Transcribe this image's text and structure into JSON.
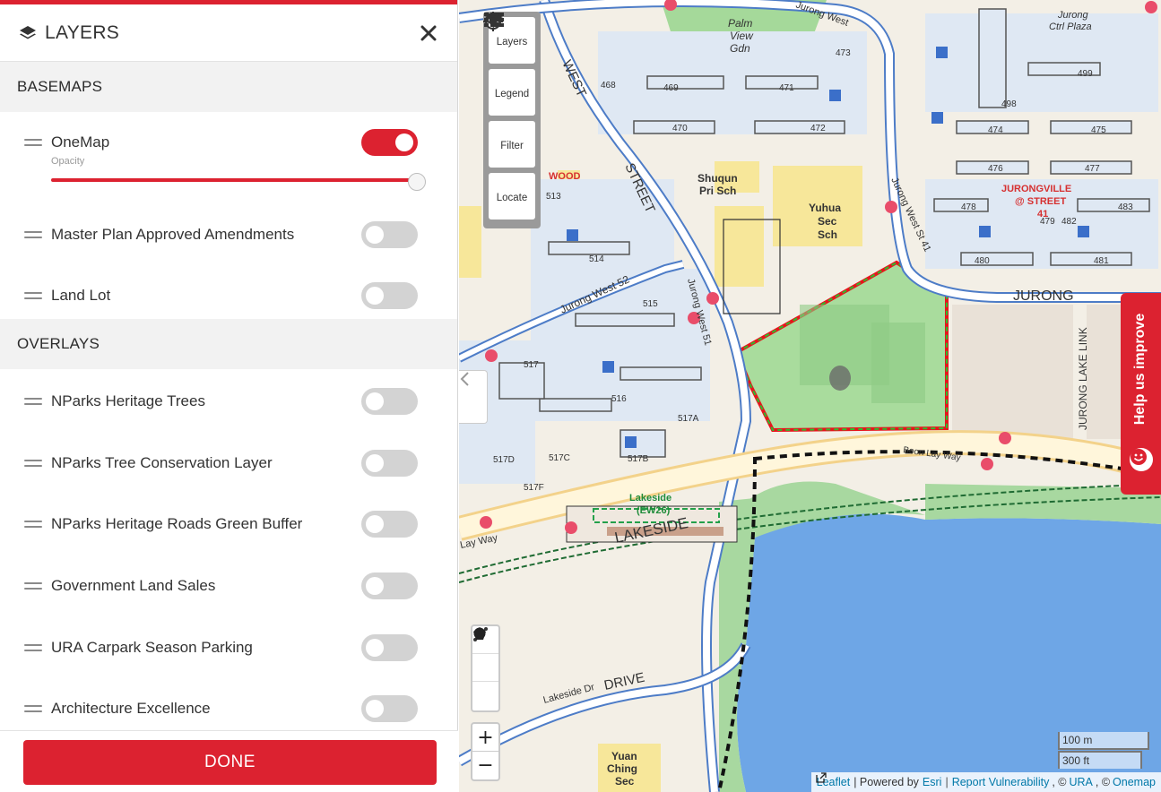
{
  "panel": {
    "title": "LAYERS",
    "close_icon": "close-icon",
    "basemaps_heading": "BASEMAPS",
    "overlays_heading": "OVERLAYS",
    "basemaps": [
      {
        "label": "OneMap",
        "enabled": true,
        "opacity_label": "Opacity",
        "opacity": 1.0
      },
      {
        "label": "Master Plan Approved Amendments",
        "enabled": false
      },
      {
        "label": "Land Lot",
        "enabled": false
      }
    ],
    "overlays": [
      {
        "label": "NParks Heritage Trees",
        "enabled": false
      },
      {
        "label": "NParks Tree Conservation Layer",
        "enabled": false
      },
      {
        "label": "NParks Heritage Roads Green Buffer",
        "enabled": false
      },
      {
        "label": "Government Land Sales",
        "enabled": false
      },
      {
        "label": "URA Carpark Season Parking",
        "enabled": false
      },
      {
        "label": "Architecture Excellence",
        "enabled": false
      }
    ],
    "done_label": "DONE"
  },
  "map_controls": {
    "layers": "Layers",
    "legend": "Legend",
    "filter": "Filter",
    "locate": "Locate",
    "zoom_in": "+",
    "zoom_out": "−"
  },
  "help_tab": "Help us improve",
  "scale": {
    "meters": "100 m",
    "feet": "300 ft"
  },
  "attribution": {
    "leaflet": "Leaflet",
    "powered_by": "| Powered by",
    "esri": "Esri",
    "sep1": "|",
    "report": "Report Vulnerability",
    "copy1": ", ©",
    "ura": "URA",
    "copy2": ", ©",
    "onemap": "Onemap"
  },
  "map_labels": {
    "jurong_street_top": "Jurong West",
    "west": "WEST",
    "street": "STREET",
    "palm_view_1": "Palm",
    "palm_view_2": "View",
    "palm_view_3": "Gdn",
    "b469": "469",
    "b471": "471",
    "b470": "470",
    "b472": "472",
    "b473": "473",
    "b468": "468",
    "b499": "499",
    "b498": "498",
    "b474": "474",
    "b475": "475",
    "b476": "476",
    "b477": "477",
    "b478": "478",
    "b483": "483",
    "b479": "479",
    "b482": "482",
    "b480": "480",
    "b481": "481",
    "b513": "513",
    "b514": "514",
    "b515": "515",
    "b516": "516",
    "b517": "517",
    "b517a": "517A",
    "b517b": "517B",
    "b517c": "517C",
    "b517d": "517D",
    "b517f": "517F",
    "jurong_ctrl_plaza_1": "Jurong",
    "jurong_ctrl_plaza_2": "Ctrl Plaza",
    "shuqun_1": "Shuqun",
    "shuqun_2": "Pri Sch",
    "yuhua_1": "Yuhua",
    "yuhua_2": "Sec",
    "yuhua_3": "Sch",
    "jurongville_1": "JURONGVILLE",
    "jurongville_2": "@ STREET",
    "jurongville_3": "41",
    "jw52": "Jurong West 52",
    "jw51": "Jurong West 51",
    "jw41": "Jurong West St 41",
    "jurong_right": "JURONG",
    "jurong_lake_link": "JURONG LAKE LINK",
    "boon_lay_way": "Boon Lay Way",
    "lay_way": "Lay Way",
    "lakeside_stn_1": "Lakeside",
    "lakeside_stn_2": "(EW26)",
    "lakeside_big": "LAKESIDE",
    "lakeside_dr": "Lakeside Dr",
    "drive": "DRIVE",
    "yuan_1": "Yuan",
    "yuan_2": "Ching",
    "yuan_3": "Sec",
    "wood": "WOOD"
  }
}
